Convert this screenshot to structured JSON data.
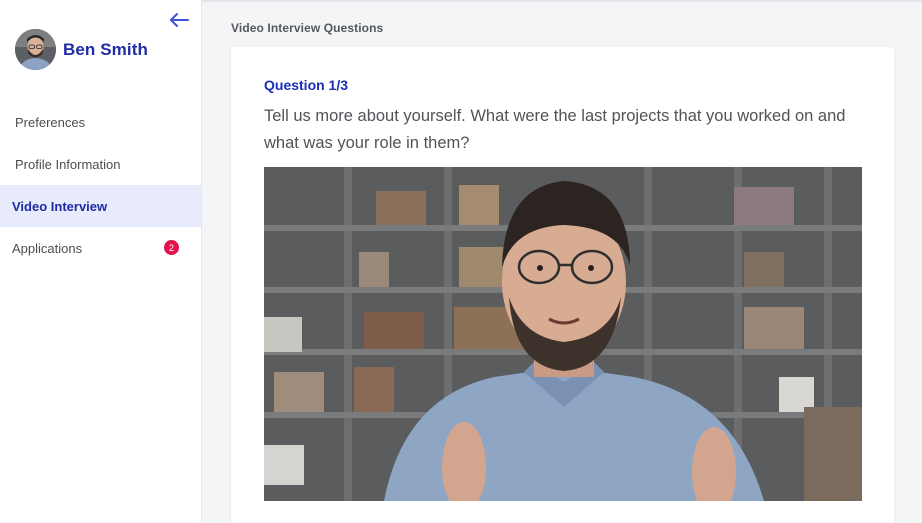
{
  "user": {
    "name": "Ben Smith"
  },
  "sidebar": {
    "items": [
      {
        "label": "Preferences"
      },
      {
        "label": "Profile Information"
      },
      {
        "label": "Video Interview",
        "active": true
      },
      {
        "label": "Applications",
        "badge": "2"
      }
    ]
  },
  "main": {
    "page_title": "Video Interview Questions",
    "question": {
      "counter": "Question 1/3",
      "text": "Tell us more about yourself. What were the last projects that you worked on and what was your role in them?"
    }
  },
  "colors": {
    "brand": "#1f2ea6",
    "active_bg": "#e8ebfb",
    "badge": "#e0134b"
  },
  "icons": {
    "back": "arrow-left-icon"
  }
}
